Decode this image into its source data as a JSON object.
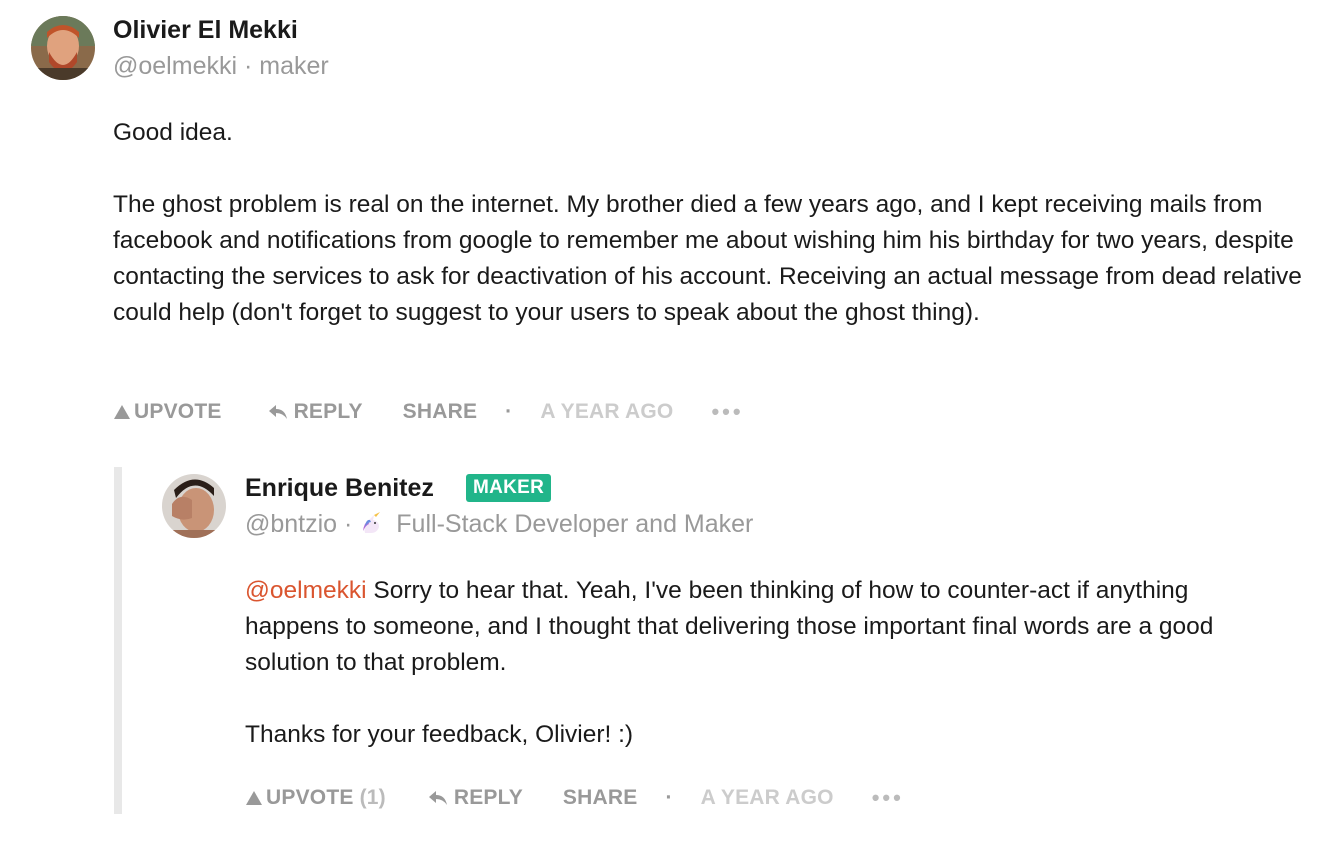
{
  "comments": [
    {
      "author": "Olivier El Mekki",
      "handle": "@oelmekki",
      "separator": "·",
      "role": "maker",
      "paragraphs": [
        "Good idea.",
        "The ghost problem is real on the internet. My brother died a few years ago, and I kept receiving mails from facebook and notifications from google to remember me about wishing him his birthday for two years, despite contacting the services to ask for deactivation of his account. Receiving an actual message from dead relative could help (don't forget to suggest to your users to speak about the ghost thing)."
      ],
      "actions": {
        "upvote": "UPVOTE",
        "reply": "REPLY",
        "share": "SHARE",
        "dot": "·",
        "time": "A YEAR AGO",
        "more": "•••"
      }
    },
    {
      "author": "Enrique Benitez",
      "badge": "MAKER",
      "handle": "@bntzio",
      "separator": "·",
      "headline_icon": "unicorn-icon",
      "headline": "Full-Stack Developer and Maker",
      "mention": "@oelmekki",
      "paragraph_1_rest": " Sorry to hear that. Yeah, I've been thinking of how to counter-act if anything happens to someone, and I thought that delivering those important final words are a good solution to that problem.",
      "paragraph_2": "Thanks for your feedback, Olivier! :)",
      "actions": {
        "upvote": "UPVOTE",
        "upvote_count": "(1)",
        "reply": "REPLY",
        "share": "SHARE",
        "dot": "·",
        "time": "A YEAR AGO",
        "more": "•••"
      }
    }
  ],
  "colors": {
    "mention": "#da552f",
    "badge": "#21b58a",
    "muted": "#999999",
    "time": "#cccccc"
  }
}
